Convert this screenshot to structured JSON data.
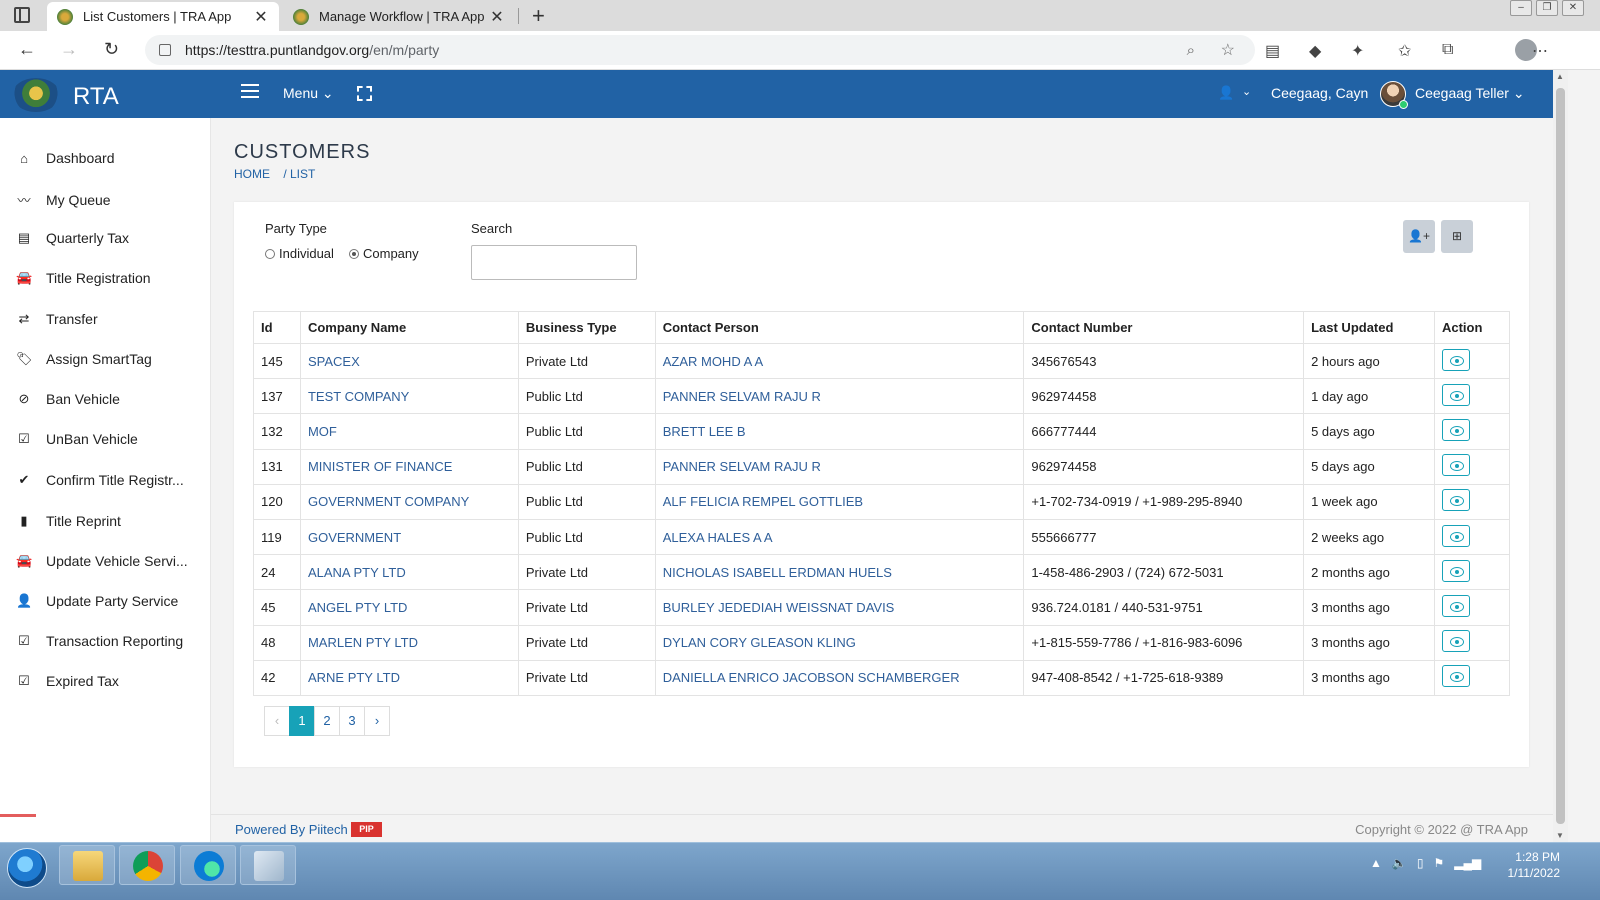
{
  "browser": {
    "tabs": [
      {
        "title": "List Customers | TRA App",
        "active": true
      },
      {
        "title": "Manage Workflow | TRA App",
        "active": false
      }
    ],
    "url_scheme_host": "https://testtra.puntlandgov.org",
    "url_path": "/en/m/party"
  },
  "header": {
    "brand": "RTA",
    "menu_label": "Menu",
    "location": "Ceegaag, Cayn",
    "user_name": "Ceegaag Teller",
    "colors": {
      "header_bg": "#2162a5",
      "accent": "#17a2b8"
    }
  },
  "sidebar": {
    "items": [
      {
        "label": "Dashboard",
        "icon": "home-icon"
      },
      {
        "label": "My Queue",
        "icon": "trend-icon"
      },
      {
        "label": "Quarterly Tax",
        "icon": "list-icon"
      },
      {
        "label": "Title Registration",
        "icon": "car-icon"
      },
      {
        "label": "Transfer",
        "icon": "transfer-icon"
      },
      {
        "label": "Assign SmartTag",
        "icon": "tags-icon"
      },
      {
        "label": "Ban Vehicle",
        "icon": "ban-icon"
      },
      {
        "label": "UnBan Vehicle",
        "icon": "checkbox-icon"
      },
      {
        "label": "Confirm Title Registr...",
        "icon": "check-icon"
      },
      {
        "label": "Title Reprint",
        "icon": "file-icon"
      },
      {
        "label": "Update Vehicle Servi...",
        "icon": "car-icon"
      },
      {
        "label": "Update Party Service",
        "icon": "user-icon"
      },
      {
        "label": "Transaction Reporting",
        "icon": "checkbox-icon"
      },
      {
        "label": "Expired Tax",
        "icon": "checkbox-icon"
      }
    ]
  },
  "page": {
    "title": "CUSTOMERS",
    "breadcrumb": [
      "HOME",
      "/ LIST"
    ]
  },
  "filters": {
    "party_type_label": "Party Type",
    "options": [
      {
        "label": "Individual",
        "checked": false
      },
      {
        "label": "Company",
        "checked": true
      }
    ],
    "search_label": "Search",
    "search_value": ""
  },
  "table": {
    "columns": [
      "Id",
      "Company Name",
      "Business Type",
      "Contact Person",
      "Contact Number",
      "Last Updated",
      "Action"
    ],
    "rows": [
      {
        "id": "145",
        "company": "SPACEX",
        "type": "Private Ltd",
        "contact": "AZAR MOHD A A",
        "number": "345676543",
        "updated": "2 hours ago"
      },
      {
        "id": "137",
        "company": "TEST COMPANY",
        "type": "Public Ltd",
        "contact": "PANNER SELVAM RAJU R",
        "number": "962974458",
        "updated": "1 day ago"
      },
      {
        "id": "132",
        "company": "MOF",
        "type": "Public Ltd",
        "contact": "BRETT LEE B",
        "number": "666777444",
        "updated": "5 days ago"
      },
      {
        "id": "131",
        "company": "MINISTER OF FINANCE",
        "type": "Public Ltd",
        "contact": "PANNER SELVAM RAJU R",
        "number": "962974458",
        "updated": "5 days ago"
      },
      {
        "id": "120",
        "company": "GOVERNMENT COMPANY",
        "type": "Public Ltd",
        "contact": "ALF FELICIA REMPEL GOTTLIEB",
        "number": "+1-702-734-0919 / +1-989-295-8940",
        "updated": "1 week ago"
      },
      {
        "id": "119",
        "company": "GOVERNMENT",
        "type": "Public Ltd",
        "contact": "ALEXA HALES A A",
        "number": "555666777",
        "updated": "2 weeks ago"
      },
      {
        "id": "24",
        "company": "ALANA PTY LTD",
        "type": "Private Ltd",
        "contact": "NICHOLAS ISABELL ERDMAN HUELS",
        "number": "1-458-486-2903 / (724) 672-5031",
        "updated": "2 months ago"
      },
      {
        "id": "45",
        "company": "ANGEL PTY LTD",
        "type": "Private Ltd",
        "contact": "BURLEY JEDEDIAH WEISSNAT DAVIS",
        "number": "936.724.0181 / 440-531-9751",
        "updated": "3 months ago"
      },
      {
        "id": "48",
        "company": "MARLEN PTY LTD",
        "type": "Private Ltd",
        "contact": "DYLAN CORY GLEASON KLING",
        "number": "+1-815-559-7786 / +1-816-983-6096",
        "updated": "3 months ago"
      },
      {
        "id": "42",
        "company": "ARNE PTY LTD",
        "type": "Private Ltd",
        "contact": "DANIELLA ENRICO JACOBSON SCHAMBERGER",
        "number": "947-408-8542 / +1-725-618-9389",
        "updated": "3 months ago"
      }
    ]
  },
  "pagination": {
    "prev": "‹",
    "pages": [
      "1",
      "2",
      "3"
    ],
    "next": "›",
    "current": "1"
  },
  "footer": {
    "powered": "Powered By Piitech",
    "badge": "PIP",
    "copyright": "Copyright © 2022 @ TRA App"
  },
  "taskbar": {
    "time": "1:28 PM",
    "date": "1/11/2022"
  }
}
